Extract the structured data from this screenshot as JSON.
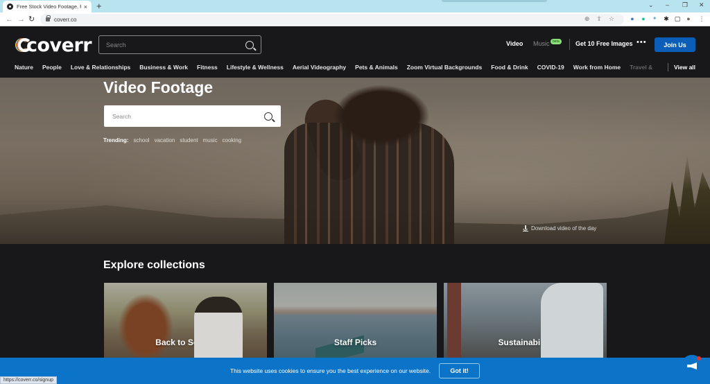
{
  "browser": {
    "tab_title": "Free Stock Video Footage, Royalty",
    "tab_close": "×",
    "new_tab": "+",
    "url": "coverr.co",
    "window_controls": {
      "chevron": "⌄",
      "minimize": "–",
      "restore": "❐",
      "close": "✕"
    },
    "status_url": "https://coverr.co/signup"
  },
  "header": {
    "logo_text": "coverr",
    "logo_colors": [
      "#f2a33a",
      "#e8453c",
      "#3a8fe0",
      "#f5e663"
    ],
    "search_placeholder": "Search",
    "nav": {
      "video": "Video",
      "music": "Music",
      "music_badge": "beta",
      "free_images": "Get 10 Free Images",
      "more": "•••",
      "join": "Join Us"
    },
    "categories": [
      "Nature",
      "People",
      "Love & Relationships",
      "Business & Work",
      "Fitness",
      "Lifestyle & Wellness",
      "Aerial Videography",
      "Pets & Animals",
      "Zoom Virtual Backgrounds",
      "Food & Drink",
      "COVID-19",
      "Work from Home",
      "Travel &"
    ],
    "view_all": "View all"
  },
  "hero": {
    "title": "Video Footage",
    "search_placeholder": "Search",
    "trending_label": "Trending:",
    "trending": [
      "school",
      "vacation",
      "student",
      "music",
      "cooking"
    ],
    "download_label": "Download video of the day"
  },
  "collections": {
    "title": "Explore collections",
    "items": [
      {
        "label": "Back to School"
      },
      {
        "label": "Staff Picks"
      },
      {
        "label": "Sustainability"
      }
    ]
  },
  "cookie": {
    "message": "This website uses cookies to ensure you the best experience on our website.",
    "button": "Got it!"
  },
  "colors": {
    "accent": "#0b5eb7",
    "cookie_bg": "#0b74c8",
    "beta_badge": "#8be07c",
    "page_bg": "#18171a"
  }
}
